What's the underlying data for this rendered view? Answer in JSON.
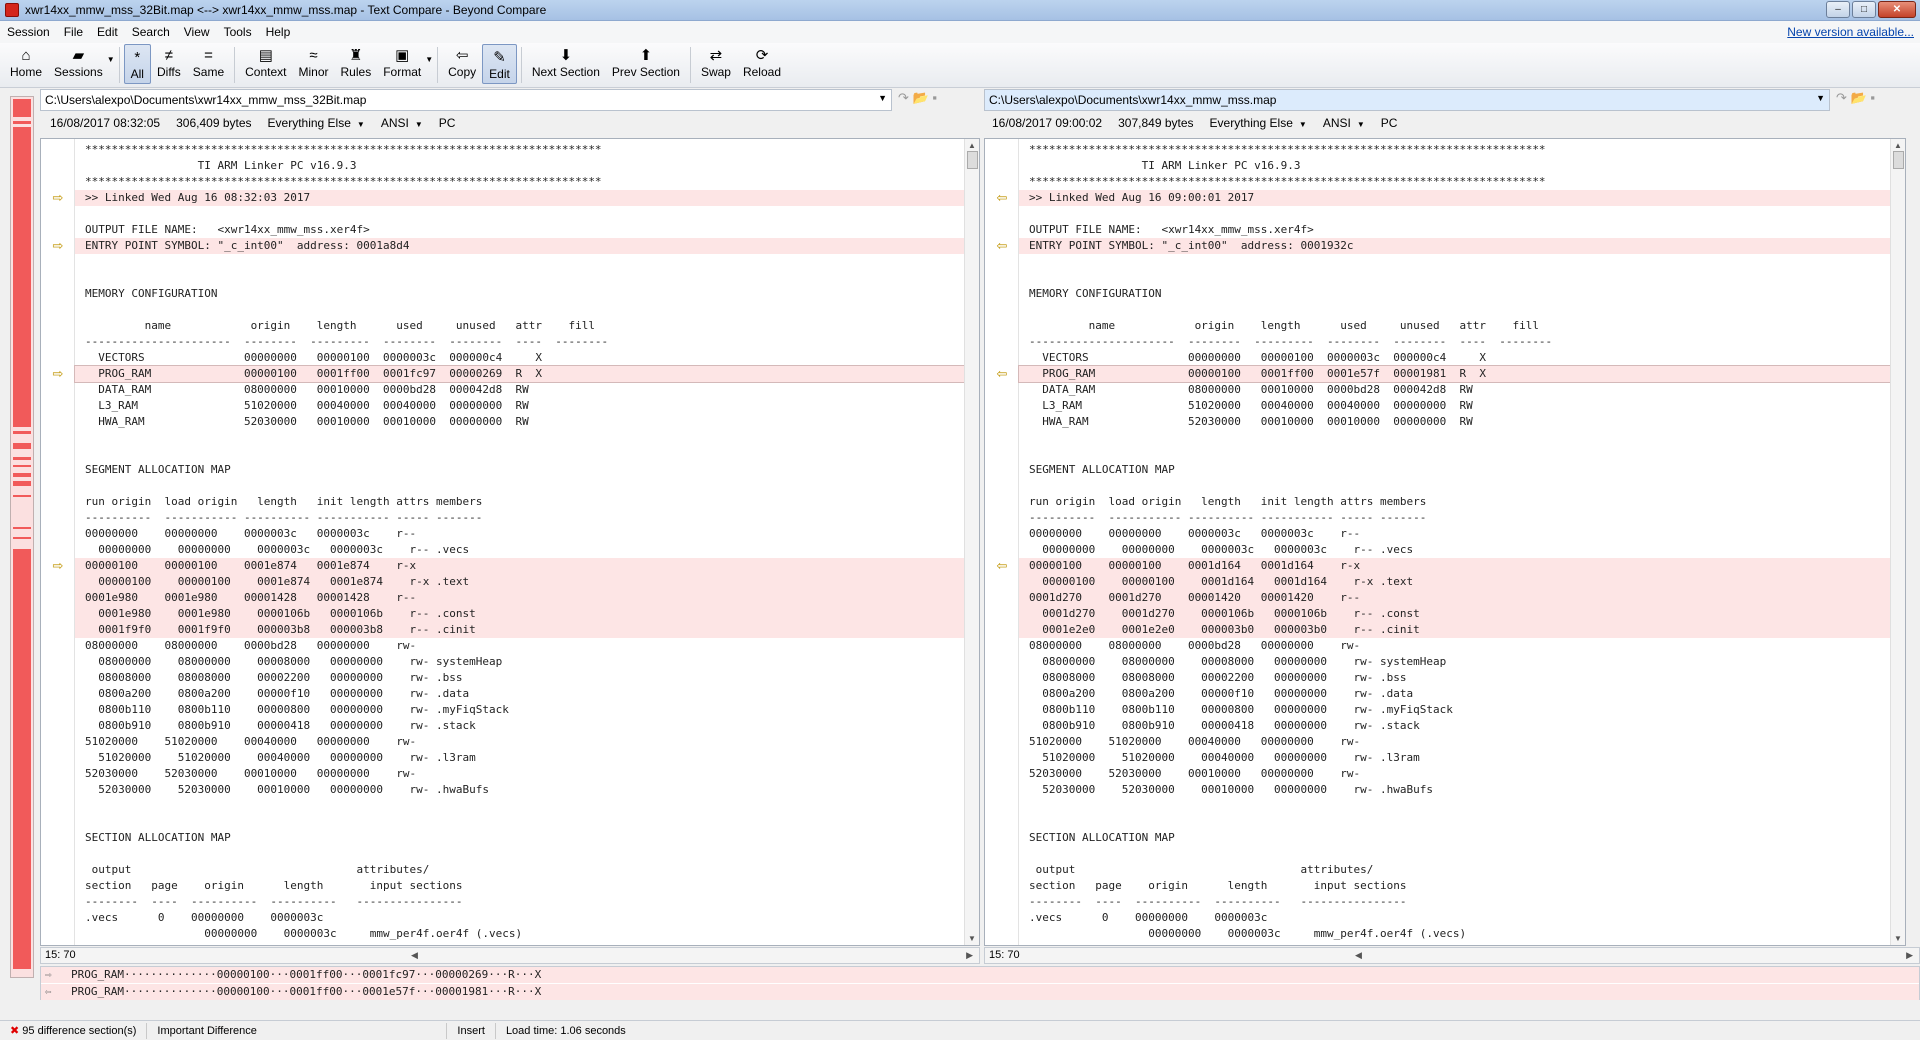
{
  "window": {
    "title": "xwr14xx_mmw_mss_32Bit.map <--> xwr14xx_mmw_mss.map - Text Compare - Beyond Compare"
  },
  "menu": {
    "items": [
      "Session",
      "File",
      "Edit",
      "Search",
      "View",
      "Tools",
      "Help"
    ],
    "new_version": "New version available..."
  },
  "toolbar": {
    "buttons": [
      {
        "id": "home",
        "label": "Home",
        "icon": "house-icon",
        "glyph": "⌂"
      },
      {
        "id": "sessions",
        "label": "Sessions",
        "icon": "folder-icon",
        "glyph": "▰"
      },
      {
        "id": "all",
        "label": "All",
        "icon": "asterisk-icon",
        "glyph": "*"
      },
      {
        "id": "diffs",
        "label": "Diffs",
        "icon": "not-equal-icon",
        "glyph": "≠"
      },
      {
        "id": "same",
        "label": "Same",
        "icon": "equal-icon",
        "glyph": "="
      },
      {
        "id": "context",
        "label": "Context",
        "icon": "context-icon",
        "glyph": "▤"
      },
      {
        "id": "minor",
        "label": "Minor",
        "icon": "approx-icon",
        "glyph": "≈"
      },
      {
        "id": "rules",
        "label": "Rules",
        "icon": "referee-icon",
        "glyph": "♜"
      },
      {
        "id": "format",
        "label": "Format",
        "icon": "format-icon",
        "glyph": "▣"
      },
      {
        "id": "copy",
        "label": "Copy",
        "icon": "copy-arrow-icon",
        "glyph": "⇦"
      },
      {
        "id": "edit",
        "label": "Edit",
        "icon": "pencil-icon",
        "glyph": "✎"
      },
      {
        "id": "next",
        "label": "Next Section",
        "icon": "down-arrow-icon",
        "glyph": "⬇"
      },
      {
        "id": "prev",
        "label": "Prev Section",
        "icon": "up-arrow-icon",
        "glyph": "⬆"
      },
      {
        "id": "swap",
        "label": "Swap",
        "icon": "swap-icon",
        "glyph": "⇄"
      },
      {
        "id": "reload",
        "label": "Reload",
        "icon": "reload-icon",
        "glyph": "⟳"
      }
    ]
  },
  "left": {
    "path": "C:\\Users\\alexpo\\Documents\\xwr14xx_mmw_mss_32Bit.map",
    "date": "16/08/2017 08:32:05",
    "size": "306,409 bytes",
    "format": "Everything Else",
    "encoding": "ANSI",
    "lineend": "PC",
    "pos": "15: 70"
  },
  "right": {
    "path": "C:\\Users\\alexpo\\Documents\\xwr14xx_mmw_mss.map",
    "date": "16/08/2017 09:00:02",
    "size": "307,849 bytes",
    "format": "Everything Else",
    "encoding": "ANSI",
    "lineend": "PC",
    "pos": "15: 70"
  },
  "left_lines": [
    {
      "t": "******************************************************************************",
      "d": false
    },
    {
      "t": "                 TI ARM Linker PC v16.9.3",
      "d": false
    },
    {
      "t": "******************************************************************************",
      "d": false
    },
    {
      "t": ">> Linked Wed Aug 16 08:32:03 2017",
      "d": true,
      "a": true
    },
    {
      "t": "",
      "d": false
    },
    {
      "t": "OUTPUT FILE NAME:   <xwr14xx_mmw_mss.xer4f>",
      "d": false
    },
    {
      "t": "ENTRY POINT SYMBOL: \"_c_int00\"  address: 0001a8d4",
      "d": true,
      "a": true
    },
    {
      "t": "",
      "d": false
    },
    {
      "t": "",
      "d": false
    },
    {
      "t": "MEMORY CONFIGURATION",
      "d": false
    },
    {
      "t": "",
      "d": false
    },
    {
      "t": "         name            origin    length      used     unused   attr    fill",
      "d": false
    },
    {
      "t": "----------------------  --------  ---------  --------  --------  ----  --------",
      "d": false
    },
    {
      "t": "  VECTORS               00000000   00000100  0000003c  000000c4     X",
      "d": false
    },
    {
      "t": "  PROG_RAM              00000100   0001ff00  0001fc97  00000269  R  X",
      "d": true,
      "a": true,
      "cur": true
    },
    {
      "t": "  DATA_RAM              08000000   00010000  0000bd28  000042d8  RW",
      "d": false
    },
    {
      "t": "  L3_RAM                51020000   00040000  00040000  00000000  RW",
      "d": false
    },
    {
      "t": "  HWA_RAM               52030000   00010000  00010000  00000000  RW",
      "d": false
    },
    {
      "t": "",
      "d": false
    },
    {
      "t": "",
      "d": false
    },
    {
      "t": "SEGMENT ALLOCATION MAP",
      "d": false
    },
    {
      "t": "",
      "d": false
    },
    {
      "t": "run origin  load origin   length   init length attrs members",
      "d": false
    },
    {
      "t": "----------  ----------- ---------- ----------- ----- -------",
      "d": false
    },
    {
      "t": "00000000    00000000    0000003c   0000003c    r--",
      "d": false
    },
    {
      "t": "  00000000    00000000    0000003c   0000003c    r-- .vecs",
      "d": false
    },
    {
      "t": "00000100    00000100    0001e874   0001e874    r-x",
      "d": true,
      "a": true
    },
    {
      "t": "  00000100    00000100    0001e874   0001e874    r-x .text",
      "d": true
    },
    {
      "t": "0001e980    0001e980    00001428   00001428    r--",
      "d": true
    },
    {
      "t": "  0001e980    0001e980    0000106b   0000106b    r-- .const",
      "d": true
    },
    {
      "t": "  0001f9f0    0001f9f0    000003b8   000003b8    r-- .cinit",
      "d": true
    },
    {
      "t": "08000000    08000000    0000bd28   00000000    rw-",
      "d": false
    },
    {
      "t": "  08000000    08000000    00008000   00000000    rw- systemHeap",
      "d": false
    },
    {
      "t": "  08008000    08008000    00002200   00000000    rw- .bss",
      "d": false
    },
    {
      "t": "  0800a200    0800a200    00000f10   00000000    rw- .data",
      "d": false
    },
    {
      "t": "  0800b110    0800b110    00000800   00000000    rw- .myFiqStack",
      "d": false
    },
    {
      "t": "  0800b910    0800b910    00000418   00000000    rw- .stack",
      "d": false
    },
    {
      "t": "51020000    51020000    00040000   00000000    rw-",
      "d": false
    },
    {
      "t": "  51020000    51020000    00040000   00000000    rw- .l3ram",
      "d": false
    },
    {
      "t": "52030000    52030000    00010000   00000000    rw-",
      "d": false
    },
    {
      "t": "  52030000    52030000    00010000   00000000    rw- .hwaBufs",
      "d": false
    },
    {
      "t": "",
      "d": false
    },
    {
      "t": "",
      "d": false
    },
    {
      "t": "SECTION ALLOCATION MAP",
      "d": false
    },
    {
      "t": "",
      "d": false
    },
    {
      "t": " output                                  attributes/",
      "d": false
    },
    {
      "t": "section   page    origin      length       input sections",
      "d": false
    },
    {
      "t": "--------  ----  ----------  ----------   ----------------",
      "d": false
    },
    {
      "t": ".vecs      0    00000000    0000003c",
      "d": false
    },
    {
      "t": "                  00000000    0000003c     mmw_per4f.oer4f (.vecs)",
      "d": false
    }
  ],
  "right_lines": [
    {
      "t": "******************************************************************************",
      "d": false
    },
    {
      "t": "                 TI ARM Linker PC v16.9.3",
      "d": false
    },
    {
      "t": "******************************************************************************",
      "d": false
    },
    {
      "t": ">> Linked Wed Aug 16 09:00:01 2017",
      "d": true,
      "a": true
    },
    {
      "t": "",
      "d": false
    },
    {
      "t": "OUTPUT FILE NAME:   <xwr14xx_mmw_mss.xer4f>",
      "d": false
    },
    {
      "t": "ENTRY POINT SYMBOL: \"_c_int00\"  address: 0001932c",
      "d": true,
      "a": true
    },
    {
      "t": "",
      "d": false
    },
    {
      "t": "",
      "d": false
    },
    {
      "t": "MEMORY CONFIGURATION",
      "d": false
    },
    {
      "t": "",
      "d": false
    },
    {
      "t": "         name            origin    length      used     unused   attr    fill",
      "d": false
    },
    {
      "t": "----------------------  --------  ---------  --------  --------  ----  --------",
      "d": false
    },
    {
      "t": "  VECTORS               00000000   00000100  0000003c  000000c4     X",
      "d": false
    },
    {
      "t": "  PROG_RAM              00000100   0001ff00  0001e57f  00001981  R  X",
      "d": true,
      "a": true,
      "cur": true
    },
    {
      "t": "  DATA_RAM              08000000   00010000  0000bd28  000042d8  RW",
      "d": false
    },
    {
      "t": "  L3_RAM                51020000   00040000  00040000  00000000  RW",
      "d": false
    },
    {
      "t": "  HWA_RAM               52030000   00010000  00010000  00000000  RW",
      "d": false
    },
    {
      "t": "",
      "d": false
    },
    {
      "t": "",
      "d": false
    },
    {
      "t": "SEGMENT ALLOCATION MAP",
      "d": false
    },
    {
      "t": "",
      "d": false
    },
    {
      "t": "run origin  load origin   length   init length attrs members",
      "d": false
    },
    {
      "t": "----------  ----------- ---------- ----------- ----- -------",
      "d": false
    },
    {
      "t": "00000000    00000000    0000003c   0000003c    r--",
      "d": false
    },
    {
      "t": "  00000000    00000000    0000003c   0000003c    r-- .vecs",
      "d": false
    },
    {
      "t": "00000100    00000100    0001d164   0001d164    r-x",
      "d": true,
      "a": true
    },
    {
      "t": "  00000100    00000100    0001d164   0001d164    r-x .text",
      "d": true
    },
    {
      "t": "0001d270    0001d270    00001420   00001420    r--",
      "d": true
    },
    {
      "t": "  0001d270    0001d270    0000106b   0000106b    r-- .const",
      "d": true
    },
    {
      "t": "  0001e2e0    0001e2e0    000003b0   000003b0    r-- .cinit",
      "d": true
    },
    {
      "t": "08000000    08000000    0000bd28   00000000    rw-",
      "d": false
    },
    {
      "t": "  08000000    08000000    00008000   00000000    rw- systemHeap",
      "d": false
    },
    {
      "t": "  08008000    08008000    00002200   00000000    rw- .bss",
      "d": false
    },
    {
      "t": "  0800a200    0800a200    00000f10   00000000    rw- .data",
      "d": false
    },
    {
      "t": "  0800b110    0800b110    00000800   00000000    rw- .myFiqStack",
      "d": false
    },
    {
      "t": "  0800b910    0800b910    00000418   00000000    rw- .stack",
      "d": false
    },
    {
      "t": "51020000    51020000    00040000   00000000    rw-",
      "d": false
    },
    {
      "t": "  51020000    51020000    00040000   00000000    rw- .l3ram",
      "d": false
    },
    {
      "t": "52030000    52030000    00010000   00000000    rw-",
      "d": false
    },
    {
      "t": "  52030000    52030000    00010000   00000000    rw- .hwaBufs",
      "d": false
    },
    {
      "t": "",
      "d": false
    },
    {
      "t": "",
      "d": false
    },
    {
      "t": "SECTION ALLOCATION MAP",
      "d": false
    },
    {
      "t": "",
      "d": false
    },
    {
      "t": " output                                  attributes/",
      "d": false
    },
    {
      "t": "section   page    origin      length       input sections",
      "d": false
    },
    {
      "t": "--------  ----  ----------  ----------   ----------------",
      "d": false
    },
    {
      "t": ".vecs      0    00000000    0000003c",
      "d": false
    },
    {
      "t": "                  00000000    0000003c     mmw_per4f.oer4f (.vecs)",
      "d": false
    }
  ],
  "compare": {
    "top": "PROG_RAM··············00000100···0001ff00···0001fc97···00000269···R···X",
    "bottom": "PROG_RAM··············00000100···0001ff00···0001e57f···00001981···R···X"
  },
  "status": {
    "sections": "95 difference section(s)",
    "importance": "Important Difference",
    "mode": "Insert",
    "load": "Load time: 1.06 seconds"
  },
  "colors": {
    "diff_bg": "#fde5e5",
    "diff_text": "#e00000",
    "overview": "#f15a5a"
  }
}
